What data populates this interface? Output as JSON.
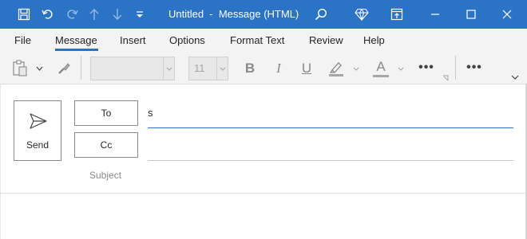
{
  "window": {
    "title": "Untitled  -  Message (HTML)",
    "accent": "#2b74c5"
  },
  "titlebar_icons": [
    "save-icon",
    "undo-icon",
    "redo-icon",
    "arrow-up-icon",
    "arrow-down-icon",
    "customize-dropdown-icon",
    "search-icon",
    "diamond-icon",
    "ribbon-display-icon",
    "minimize-icon",
    "maximize-icon",
    "close-icon"
  ],
  "menu": {
    "items": [
      "File",
      "Message",
      "Insert",
      "Options",
      "Format Text",
      "Review",
      "Help"
    ],
    "active": "Message"
  },
  "ribbon": {
    "font_name": "",
    "font_size": "11",
    "bold": "B",
    "italic": "I",
    "underline": "U",
    "font_color": "A",
    "more1": "•••",
    "more2": "•••"
  },
  "compose": {
    "send_label": "Send",
    "to_label": "To",
    "cc_label": "Cc",
    "subject_label": "Subject",
    "to_value": "s",
    "cc_value": "",
    "subject_value": ""
  }
}
